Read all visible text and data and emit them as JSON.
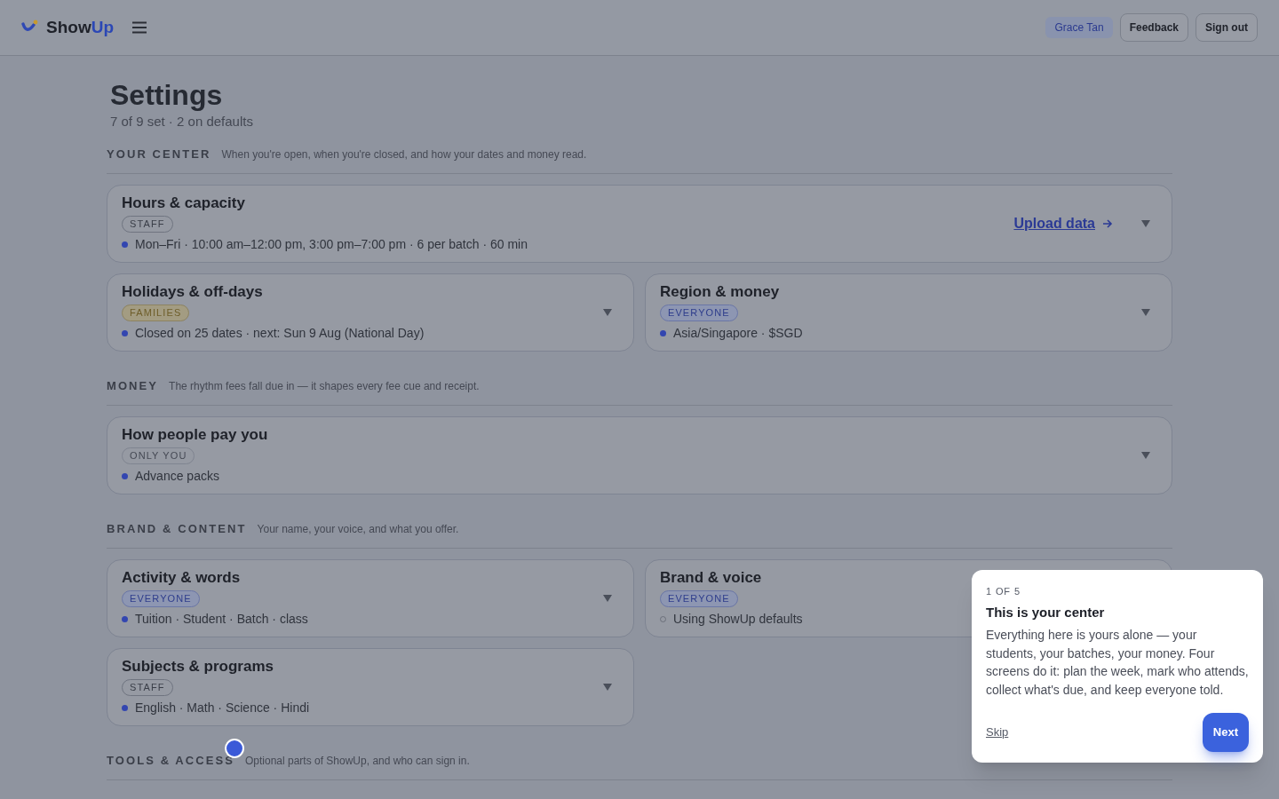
{
  "brand": {
    "name_first": "Show",
    "name_second": "Up"
  },
  "header": {
    "user": "Grace Tan",
    "buttons": [
      "Feedback",
      "Sign out"
    ]
  },
  "page": {
    "title": "Settings",
    "subtitle": "7 of 9 set · 2 on defaults"
  },
  "sections": [
    {
      "title": "YOUR CENTER",
      "description": "When you're open, when you're closed, and how your dates and money read.",
      "cards": [
        {
          "title": "Hours & capacity",
          "audience": "STAFF",
          "kind": "staff",
          "summary": "Mon–Fri · 10:00 am–12:00 pm, 3:00 pm–7:00 pm · 6 per batch · 60 min",
          "set": true,
          "wide": true,
          "link": "Upload data"
        },
        {
          "title": "Holidays & off-days",
          "audience": "FAMILIES",
          "kind": "families",
          "summary": "Closed on 25 dates · next: Sun 9 Aug (National Day)",
          "set": true,
          "wide": false
        },
        {
          "title": "Region & money",
          "audience": "EVERYONE",
          "kind": "everyone",
          "summary": "Asia/Singapore · $SGD",
          "set": true,
          "wide": false
        }
      ]
    },
    {
      "title": "MONEY",
      "description": "The rhythm fees fall due in — it shapes every fee cue and receipt.",
      "cards": [
        {
          "title": "How people pay you",
          "audience": "ONLY YOU",
          "kind": "only_you",
          "summary": "Advance packs",
          "set": true,
          "wide": true
        }
      ]
    },
    {
      "title": "BRAND & CONTENT",
      "description": "Your name, your voice, and what you offer.",
      "cards": [
        {
          "title": "Activity & words",
          "audience": "EVERYONE",
          "kind": "everyone",
          "summary": "Tuition · Student · Batch · class",
          "set": true,
          "wide": false
        },
        {
          "title": "Brand & voice",
          "audience": "EVERYONE",
          "kind": "everyone",
          "summary": "Using ShowUp defaults",
          "set": false,
          "wide": false
        },
        {
          "title": "Subjects & programs",
          "audience": "STAFF",
          "kind": "staff",
          "summary": "English · Math · Science · Hindi",
          "set": true,
          "wide": false
        }
      ]
    },
    {
      "title": "TOOLS & ACCESS",
      "description": "Optional parts of ShowUp, and who can sign in.",
      "tour_anchor": true
    }
  ],
  "tour": {
    "step": "1 OF 5",
    "title": "This is your center",
    "body": "Everything here is yours alone — your students, your batches, your money. Four screens do it: plan the week, mark who attends, collect what's due, and keep everyone told.",
    "skip": "Skip",
    "next": "Next"
  }
}
